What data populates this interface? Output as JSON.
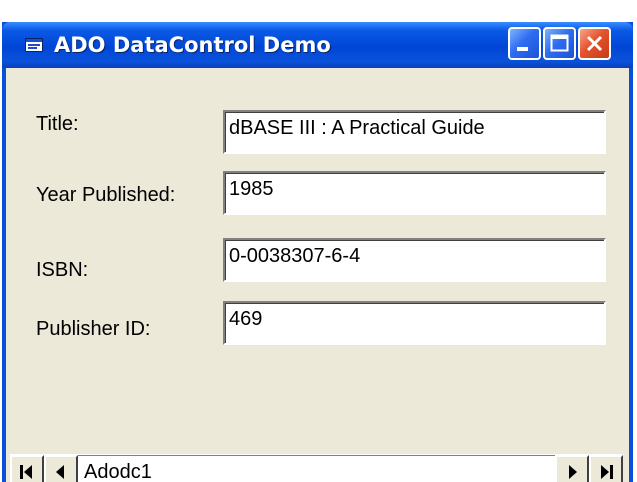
{
  "window": {
    "title": "ADO DataControl Demo"
  },
  "form": {
    "fields": [
      {
        "label": "Title:",
        "value": "dBASE III : A Practical Guide"
      },
      {
        "label": "Year Published:",
        "value": "1985"
      },
      {
        "label": "ISBN:",
        "value": "0-0038307-6-4"
      },
      {
        "label": "Publisher ID:",
        "value": "469"
      }
    ]
  },
  "data_control": {
    "caption": "Adodc1",
    "buttons": [
      "move-first",
      "move-previous",
      "move-next",
      "move-last"
    ]
  },
  "icons": {
    "app": "app-window-icon",
    "minimize": "minimize-icon",
    "maximize": "maximize-icon",
    "close": "close-icon"
  },
  "colors": {
    "titlebar": "#0a4fd8",
    "client_background": "#ece9d8",
    "close_button": "#e3542e"
  }
}
